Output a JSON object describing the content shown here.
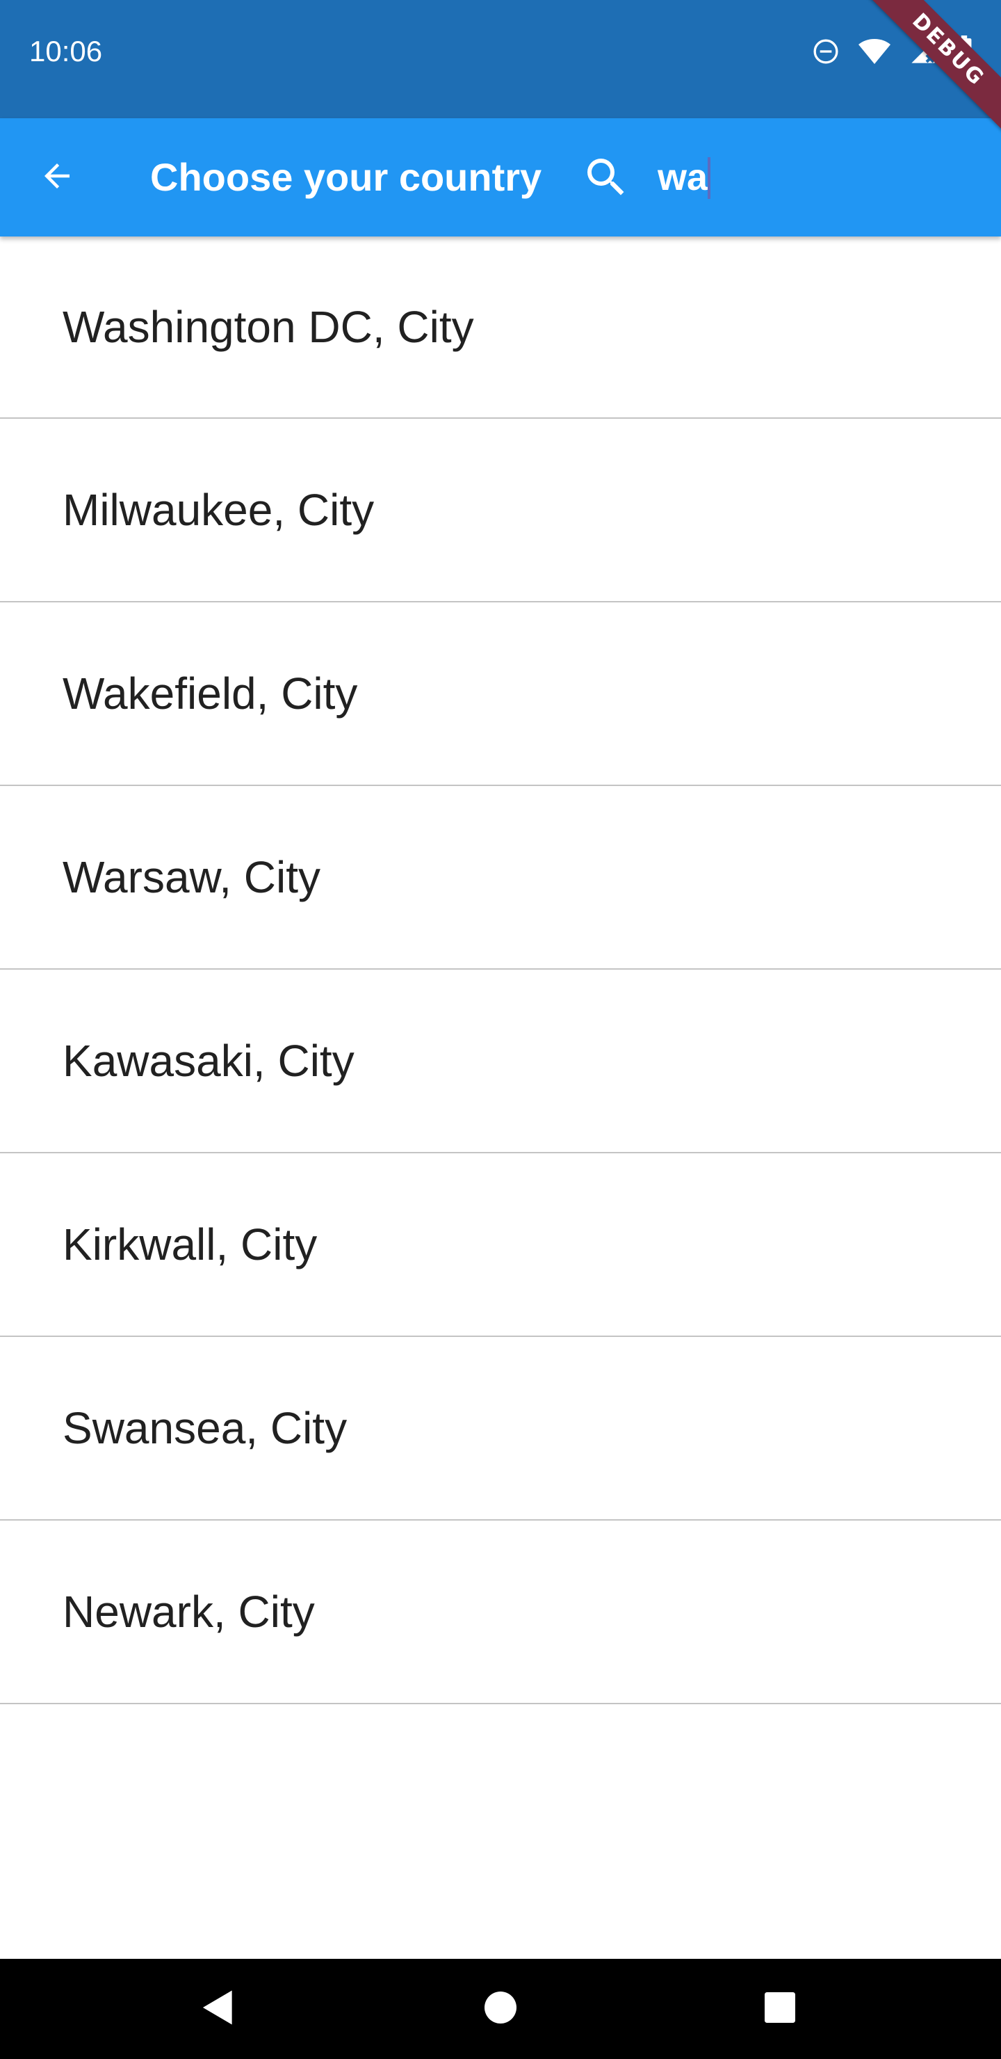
{
  "status_bar": {
    "time": "10:06",
    "icons": [
      "do-not-disturb-icon",
      "wifi-icon",
      "signal-icon",
      "battery-icon"
    ]
  },
  "debug_banner": "DEBUG",
  "app_bar": {
    "title": "Choose your country",
    "back_icon": "arrow-back-icon",
    "search_icon": "search-icon",
    "search_value": "wa"
  },
  "cities": [
    {
      "label": "Washington DC, City"
    },
    {
      "label": "Milwaukee, City"
    },
    {
      "label": "Wakefield, City"
    },
    {
      "label": "Warsaw, City"
    },
    {
      "label": "Kawasaki, City"
    },
    {
      "label": "Kirkwall, City"
    },
    {
      "label": "Swansea, City"
    },
    {
      "label": "Newark, City"
    }
  ],
  "nav_bar": {
    "icons": [
      "nav-back-icon",
      "nav-home-icon",
      "nav-recents-icon"
    ]
  },
  "colors": {
    "status_bar": "#1e6eb4",
    "app_bar": "#2196f3",
    "debug_ribbon": "#7b2a3f",
    "text": "#212121",
    "divider": "#c4c4c4"
  }
}
